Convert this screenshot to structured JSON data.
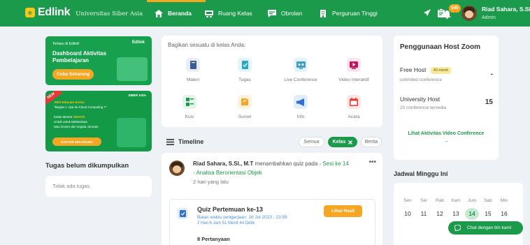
{
  "brand": {
    "name": "Edlink",
    "university": "Universitas Siber Asia",
    "badge_letter": "e"
  },
  "nav": {
    "beranda": "Beranda",
    "ruang_kelas": "Ruang Kelas",
    "obrolan": "Obrolan",
    "perguruan_tinggi": "Perguruan Tinggi"
  },
  "user": {
    "name": "Riad Sahara, S.SI.,",
    "role": "Admin",
    "notification_count": "545"
  },
  "promo1": {
    "small": "Terbaru di Edlink!",
    "logo": "Edlink",
    "title": "Dashboard Aktivitas Pembelajaran",
    "button": "Coba Sekarang"
  },
  "promo2": {
    "new": "NEW",
    "brand": "SIBER ASIA",
    "line1": "AWS Educate Series",
    "line2": "\"Begian I: Apa itu Cloud Computing ?\"",
    "line3_prefix": "Kelas Mentor",
    "line3_free": "GRATIS",
    "line4": "Untuk untuk Mahasiswa",
    "line5": "atau Dosen dari segala Jurusan",
    "button": "DAFTAR SEKARANG"
  },
  "tugas": {
    "heading": "Tugas belum dikumpulkan",
    "empty": "Tidak ada tugas."
  },
  "share": {
    "title": "Bagikan sesuatu di kelas Anda:",
    "items": [
      {
        "label": "Materi",
        "icon": "book-icon",
        "color": "#3d5a98",
        "bg": "#e8edf7"
      },
      {
        "label": "Tugas",
        "icon": "assignment-icon",
        "color": "#2aa6c9",
        "bg": "#e3f5fa"
      },
      {
        "label": "Live Conference",
        "icon": "video-conference-icon",
        "color": "#3a9fc9",
        "bg": "#e4f2f9"
      },
      {
        "label": "Video Interaktif",
        "icon": "play-video-icon",
        "color": "#c2185b",
        "bg": "#fce4ec"
      },
      {
        "label": "Kuis",
        "icon": "quiz-icon",
        "color": "#1b9a4c",
        "bg": "#e3f4e9"
      },
      {
        "label": "Survei",
        "icon": "survey-icon",
        "color": "#f5a623",
        "bg": "#fdf2dc"
      },
      {
        "label": "Info",
        "icon": "megaphone-icon",
        "color": "#2f6fd6",
        "bg": "#e3ecfb"
      },
      {
        "label": "Acara",
        "icon": "calendar-event-icon",
        "color": "#e53935",
        "bg": "#fde5e4"
      }
    ]
  },
  "timeline": {
    "label": "Timeline",
    "filters": {
      "semua": "Semua",
      "kelas": "Kelas",
      "berita": "Berita"
    }
  },
  "post": {
    "author": "Riad Sahara, S.SI., M.T",
    "action": "menambahkan quiz pada",
    "session": "Sesi ke 14",
    "topic": "Analisa Berorientasi Objek",
    "time_ago": "2 hari yang lalu",
    "quiz": {
      "title": "Quiz Pertemuan ke-13",
      "deadline": "Batas waktu pengerjaan: 16 Jul 2023 , 23:59",
      "remaining": "2 Hari 6 Jam 51 Menit 44 Detik",
      "button": "Lihat Hasil",
      "questions": "8 Pertanyaan"
    }
  },
  "zoom": {
    "title": "Penggunaan Host Zoom",
    "free_name": "Free Host",
    "free_badge": "40 menit",
    "free_sub": "unlimited conference",
    "free_value": "-",
    "univ_name": "University Host",
    "univ_sub": "20 conference tersedia",
    "univ_value": "15",
    "link": "Lihat Aktivitas Video Conference",
    "link_arrow": "→"
  },
  "jadwal": {
    "heading": "Jadwal Minggu Ini",
    "days": [
      "Sen",
      "Sel",
      "Rab",
      "Kam",
      "Jum",
      "Sab",
      "Min"
    ],
    "dates": [
      "10",
      "11",
      "12",
      "13",
      "14",
      "15",
      "16"
    ],
    "today_index": 4
  },
  "chat": {
    "label": "Chat dengan tim kami"
  },
  "colors": {
    "primary": "#1b9a4c",
    "accent": "#f5a623",
    "background": "#eef1f5"
  }
}
